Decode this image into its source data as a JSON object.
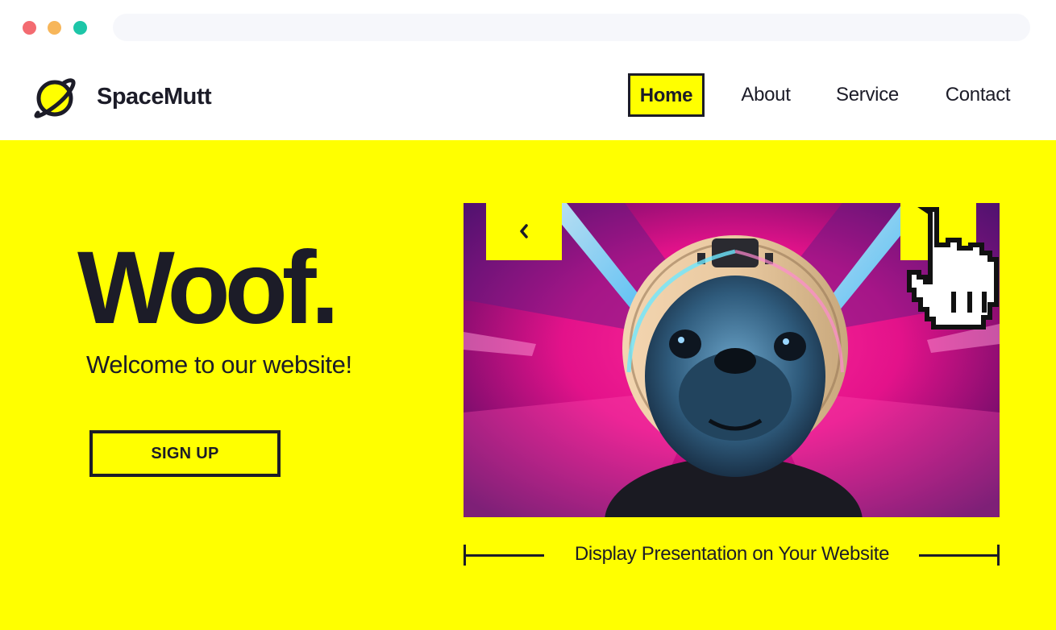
{
  "browser": {
    "window_controls": [
      "close",
      "minimize",
      "maximize"
    ]
  },
  "header": {
    "brand": "SpaceMutt",
    "logo_icon": "planet-icon",
    "nav": [
      {
        "label": "Home",
        "active": true
      },
      {
        "label": "About",
        "active": false
      },
      {
        "label": "Service",
        "active": false
      },
      {
        "label": "Contact",
        "active": false
      }
    ]
  },
  "hero": {
    "title": "Woof.",
    "subtitle": "Welcome to our website!",
    "cta_label": "SIGN UP",
    "background_color": "#ffff00"
  },
  "slider": {
    "prev_icon": "chevron-left-icon",
    "next_icon": "chevron-right-icon",
    "image": "pug-astronaut-photo",
    "caption": "Display Presentation on Your Website"
  },
  "colors": {
    "accent": "#ffff00",
    "text": "#1c1c28",
    "neon_pink": "#ff1493",
    "neon_cyan": "#5ee7ff"
  }
}
